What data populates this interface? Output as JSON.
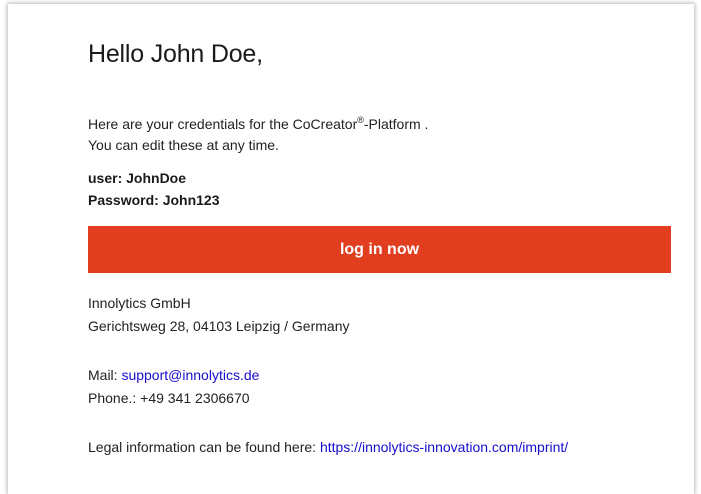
{
  "email": {
    "greeting": "Hello John Doe,",
    "intro_before_mark": "Here are your credentials for the CoCreator",
    "registered_mark": "®",
    "intro_after_mark": "-Platform .",
    "intro_line2": "You can edit these at any time.",
    "user_line": "user: JohnDoe",
    "password_line": "Password: John123",
    "login_button_label": "log in now",
    "company_name": "Innolytics GmbH",
    "company_address": "Gerichtsweg 28, 04103 Leipzig / Germany",
    "mail_label": "Mail: ",
    "mail_address": "support@innolytics.de",
    "phone_line": "Phone.: +49 341 2306670",
    "legal_text": "Legal information can be found here: ",
    "legal_link": "https://innolytics-innovation.com/imprint/"
  },
  "colors": {
    "button_background": "#e03e1e",
    "button_text": "#ffffff",
    "link": "#1a0dcc"
  }
}
